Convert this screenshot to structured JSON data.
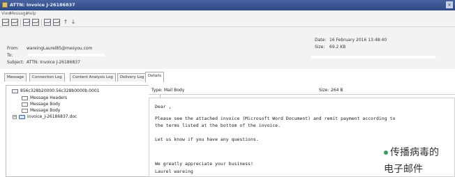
{
  "window": {
    "title": "ATTN: Invoice J-26186837",
    "close_glyph": "×"
  },
  "menu": {
    "items": [
      "View",
      "Message",
      "Help"
    ]
  },
  "toolbar": {
    "arrow_up": "↑",
    "arrow_down": "↓"
  },
  "header": {
    "from_label": "From:",
    "from_value": "wareingLaurel85@mesyou.com",
    "to_label": "To:",
    "subject_label": "Subject:",
    "subject_value": "ATTN: Invoice J-26186837",
    "date_label": "Date:",
    "date_value": "16 February 2016 13:48:40",
    "size_label": "Size:",
    "size_value": "69.2 KB"
  },
  "tabs": [
    "Message",
    "Connection Log",
    "Content Analysis Log",
    "Delivery Log",
    "Details"
  ],
  "tree": {
    "root": "856c328b20000.56c328b0000b.0001",
    "items": [
      "Message Headers",
      "Message Body",
      "Message Body",
      "invoice_J-26186837.doc"
    ],
    "expand_glyph": "+"
  },
  "detail": {
    "type_label": "Type:",
    "type_value": "Mail Body",
    "size_label": "Size:",
    "size_value": "264 B"
  },
  "email_body": {
    "lines": [
      "Dear          ,",
      "Please see the attached invoice (Microsoft Word Document) and remit payment according to",
      "the terms listed at the bottom of the invoice.",
      "Let us know if you have any questions.",
      "We greatly appreciate your business!",
      "Laurel wareing"
    ]
  },
  "caption": {
    "line1": "传播病毒的",
    "line2": "电子邮件",
    "bullet_color": "#3c9a5f"
  }
}
